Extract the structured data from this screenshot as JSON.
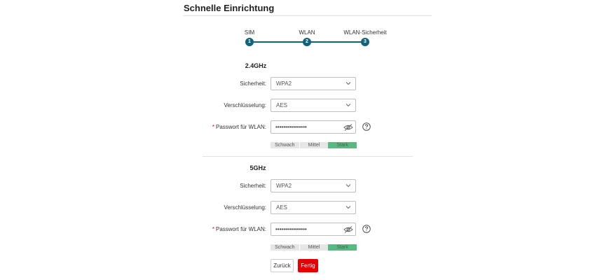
{
  "page": {
    "title": "Schnelle Einrichtung"
  },
  "steps": [
    {
      "label": "SIM",
      "number": "1"
    },
    {
      "label": "WLAN",
      "number": "2"
    },
    {
      "label": "WLAN-Sicherheit",
      "number": "3"
    }
  ],
  "band24": {
    "heading": "2.4GHz",
    "security_label": "Sicherheit:",
    "security_value": "WPA2",
    "encryption_label": "Verschlüsselung:",
    "encryption_value": "AES",
    "required_mark": "*",
    "password_label": "Passwort für WLAN:",
    "password_value": "••••••••••••••••",
    "strength": {
      "weak": "Schwach",
      "medium": "Mittel",
      "strong": "Stark",
      "level": "strong"
    }
  },
  "band5": {
    "heading": "5GHz",
    "security_label": "Sicherheit:",
    "security_value": "WPA2",
    "encryption_label": "Verschlüsselung:",
    "encryption_value": "AES",
    "required_mark": "*",
    "password_label": "Passwort für WLAN:",
    "password_value": "••••••••••••••••",
    "strength": {
      "weak": "Schwach",
      "medium": "Mittel",
      "strong": "Stark",
      "level": "strong"
    }
  },
  "buttons": {
    "back": "Zurück",
    "done": "Fertig"
  },
  "colors": {
    "accent": "#10637a",
    "primary_button": "#e60000",
    "strength_strong": "#5ab982",
    "required": "#e60000"
  },
  "icons": {
    "dropdown": "chevron-down-icon",
    "toggle_password": "eye-icon",
    "help": "question-circle-icon"
  }
}
